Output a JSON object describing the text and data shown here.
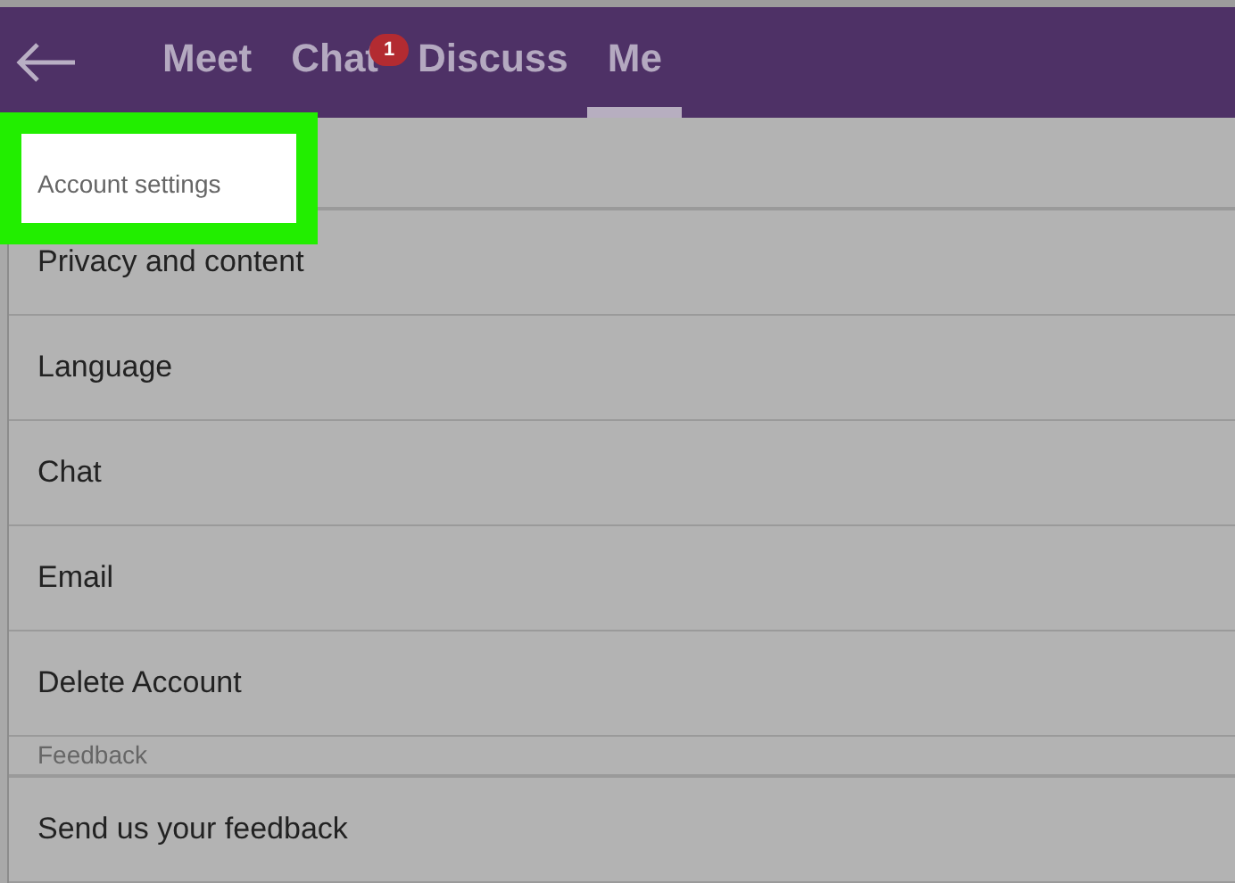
{
  "tabs": [
    {
      "label": "Meet",
      "selected": false
    },
    {
      "label": "Chat",
      "selected": false,
      "badge": "1"
    },
    {
      "label": "Discuss",
      "selected": false
    },
    {
      "label": "Me",
      "selected": true
    }
  ],
  "sections": [
    {
      "title": "Account settings",
      "highlighted": true,
      "items": [
        {
          "label": "Privacy and content"
        },
        {
          "label": "Language"
        },
        {
          "label": "Chat"
        },
        {
          "label": "Email"
        },
        {
          "label": "Delete Account"
        }
      ]
    },
    {
      "title": "Feedback",
      "highlighted": false,
      "items": [
        {
          "label": "Send us your feedback"
        }
      ]
    }
  ]
}
